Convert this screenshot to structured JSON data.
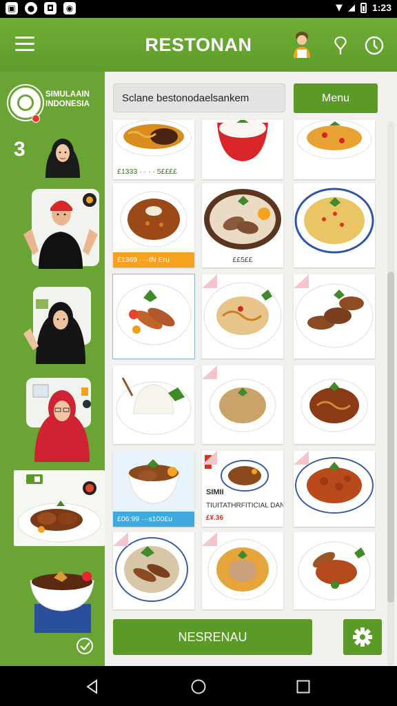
{
  "status_bar": {
    "time": "1:23",
    "left_icons": [
      "image-icon",
      "record-icon",
      "shield-icon",
      "camera-icon"
    ]
  },
  "header": {
    "title": "RESTONAN"
  },
  "sidebar": {
    "brand_name": "SIMULAAIN INDONESIA",
    "count": "3"
  },
  "search": {
    "value": "Sclane bestonodaelsankem"
  },
  "toolbar": {
    "menu_label": "Menu"
  },
  "menu_grid": [
    {
      "dish": "mie-goreng",
      "tag": "£1333 · · · · 5££££"
    },
    {
      "dish": "nasi-putih",
      "tag": ""
    },
    {
      "dish": "mie-pedas",
      "tag": ""
    },
    {
      "dish": "rendang-sauce",
      "tag": "£1369  ····tN Eru"
    },
    {
      "dish": "pepes-ikan",
      "tag": "££5££"
    },
    {
      "dish": "nasi-kuning",
      "tag": ""
    },
    {
      "dish": "sate-sayur",
      "tag": ""
    },
    {
      "dish": "mie-sayur",
      "tag": ""
    },
    {
      "dish": "ayam-bakar",
      "tag": ""
    },
    {
      "dish": "nasi-putih-daun",
      "tag": ""
    },
    {
      "dish": "nasi-goreng",
      "tag": ""
    },
    {
      "dish": "mie-kuah",
      "tag": ""
    },
    {
      "dish": "semur-daging",
      "tag": "£06:99  ···s100£u"
    },
    {
      "dish": "ayam-kecap",
      "promo_title": "SIMII",
      "promo_desc": "TIUITATHRFITICIAL DAN",
      "promo_price": "£¥.36"
    },
    {
      "dish": "ayam-pedas",
      "tag": ""
    },
    {
      "dish": "sate-campur",
      "tag": ""
    },
    {
      "dish": "kari-ikan",
      "tag": ""
    },
    {
      "dish": "ikan-goreng",
      "tag": ""
    }
  ],
  "actions": {
    "order_label": "NESRENAU"
  },
  "colors": {
    "brand_green": "#5c9a28",
    "sidebar_green": "#6aa434",
    "price_orange": "#f6a21e",
    "price_blue": "#3ea9df"
  }
}
